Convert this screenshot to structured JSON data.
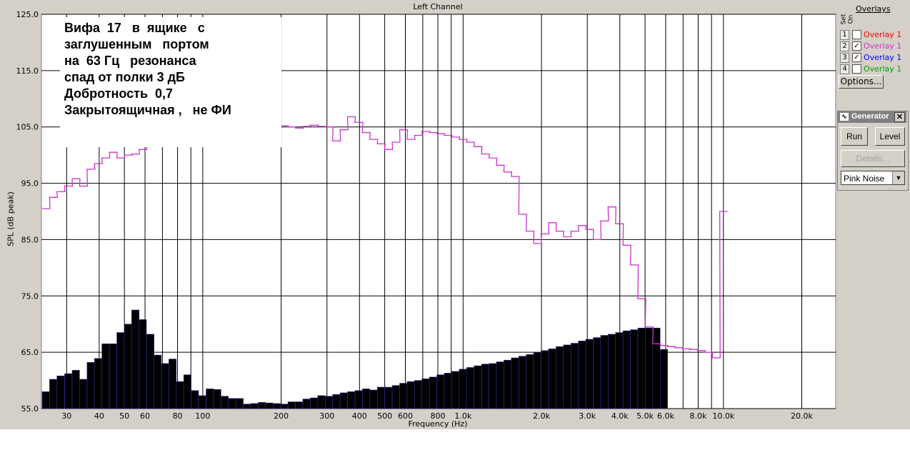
{
  "chart_data": {
    "type": "bar",
    "title": "Left Channel",
    "xlabel": "Frequency (Hz)",
    "ylabel": "SPL (dB peak)",
    "xscale": "log",
    "xlim": [
      24,
      27000
    ],
    "ylim": [
      55,
      125
    ],
    "grid": true,
    "yticks": [
      "125.0",
      "115.0",
      "105.0",
      "95.0",
      "85.0",
      "75.0",
      "65.0",
      "55.0"
    ],
    "xticks": [
      {
        "label": "30",
        "value": 30
      },
      {
        "label": "40",
        "value": 40
      },
      {
        "label": "50",
        "value": 50
      },
      {
        "label": "60",
        "value": 60
      },
      {
        "label": "80",
        "value": 80
      },
      {
        "label": "100",
        "value": 100
      },
      {
        "label": "200",
        "value": 200
      },
      {
        "label": "300",
        "value": 300
      },
      {
        "label": "400",
        "value": 400
      },
      {
        "label": "500",
        "value": 500
      },
      {
        "label": "600",
        "value": 600
      },
      {
        "label": "800",
        "value": 800
      },
      {
        "label": "1.0k",
        "value": 1000
      },
      {
        "label": "2.0k",
        "value": 2000
      },
      {
        "label": "3.0k",
        "value": 3000
      },
      {
        "label": "4.0k",
        "value": 4000
      },
      {
        "label": "5.0k",
        "value": 5000
      },
      {
        "label": "6.0k",
        "value": 6000
      },
      {
        "label": "8.0k",
        "value": 8000
      },
      {
        "label": "10.0k",
        "value": 10000
      },
      {
        "label": "20.0k",
        "value": 20000
      }
    ],
    "minor_gridlines": [
      70,
      90,
      700,
      900,
      7000,
      9000
    ],
    "band_centers": [
      25,
      26.7,
      28.5,
      30.5,
      32.6,
      34.8,
      37.2,
      39.7,
      42.4,
      45.3,
      48.4,
      51.7,
      55.2,
      58.9,
      63,
      67.2,
      71.8,
      76.7,
      81.9,
      87.5,
      93.4,
      99.8,
      106.6,
      113.9,
      121.6,
      129.9,
      138.7,
      148.2,
      158.2,
      169,
      180.5,
      192.8,
      205.9,
      219.9,
      234.9,
      250.9,
      268,
      286.2,
      305.7,
      326.5,
      348.7,
      372.4,
      397.8,
      424.9,
      453.8,
      484.7,
      517.7,
      552.9,
      590.5,
      630.7,
      673.6,
      719.5,
      768.5,
      820.8,
      876.6,
      936.3,
      1000,
      1068,
      1141,
      1219,
      1302,
      1390,
      1485,
      1586,
      1694,
      1809,
      1932,
      2064,
      2204,
      2354,
      2515,
      2686,
      2869,
      3064,
      3273,
      3495,
      3733,
      3987,
      4259,
      4548,
      4858,
      5188,
      5541,
      5919,
      6321,
      6752,
      7211,
      7702,
      8226,
      8786,
      9384,
      10020,
      10710,
      11440,
      12210,
      13050,
      13930,
      14880,
      15890,
      16980,
      18130,
      19370,
      20680,
      22090,
      23590,
      25200
    ],
    "series": [
      {
        "values": [
          58.0,
          60.2,
          60.8,
          61.2,
          61.8,
          60.2,
          63.2,
          63.9,
          66.5,
          66.5,
          68.5,
          70.0,
          72.5,
          70.8,
          68.2,
          64.5,
          63.0,
          63.8,
          59.8,
          61.0,
          58.2,
          57.3,
          58.5,
          58.4,
          57.2,
          56.8,
          56.8,
          55.8,
          55.9,
          56.1,
          56.0,
          55.9,
          55.8,
          56.2,
          56.2,
          56.7,
          56.9,
          57.3,
          57.2,
          57.5,
          57.8,
          58.0,
          58.2,
          58.5,
          58.3,
          58.8,
          58.8,
          59.1,
          59.5,
          59.8,
          60.0,
          60.3,
          60.6,
          61.0,
          61.3,
          61.6,
          62.0,
          62.3,
          62.6,
          62.9,
          63.0,
          63.3,
          63.6,
          64.0,
          64.3,
          64.6,
          65.0,
          65.3,
          65.6,
          66.0,
          66.3,
          66.6,
          67.0,
          67.3,
          67.6,
          68.0,
          68.2,
          68.5,
          68.8,
          69.0,
          69.3,
          69.3,
          69.3,
          65.5
        ],
        "color": "#000000"
      },
      {
        "values": [
          90.5,
          92.5,
          93.5,
          94.5,
          95.8,
          94.5,
          97.5,
          98.5,
          99.5,
          100.5,
          99.5,
          100.0,
          100.2,
          101.0,
          101.5,
          102.0,
          102.5,
          103.0,
          103.5,
          104.0,
          104.5,
          104.5,
          105.0,
          105.2,
          105.3,
          105.5,
          105.5,
          105.5,
          105.4,
          105.3,
          105.3,
          105.3,
          105.2,
          105.0,
          104.8,
          105.1,
          105.3,
          105.1,
          105.0,
          102.5,
          104.5,
          106.8,
          105.8,
          104.0,
          102.8,
          102.0,
          101.0,
          102.3,
          104.5,
          102.8,
          103.5,
          104.2,
          104.0,
          103.8,
          103.5,
          103.2,
          102.8,
          102.3,
          101.5,
          100.2,
          99.5,
          98.2,
          97.0,
          96.2,
          89.5,
          86.5,
          84.3,
          86.0,
          88.0,
          86.5,
          85.5,
          86.5,
          87.5,
          86.8,
          85.0,
          88.3,
          90.8,
          87.8,
          84.0,
          80.5,
          74.5,
          69.5,
          66.5,
          66.2,
          66.0,
          65.8,
          65.6,
          65.5,
          65.3,
          65.0,
          64.0,
          90.0
        ],
        "color": "#cc33cc"
      }
    ]
  },
  "annotation": {
    "lines": [
      "Вифа  17   в  ящике   с",
      "заглушенным   портом",
      "на  63 Гц   резонанса",
      "спад от полки 3 дБ",
      "Добротность  0,7",
      "Закрытоящичная ,   не ФИ"
    ]
  },
  "side_panel": {
    "title": "Overlays",
    "set_label": "Set",
    "on_label": "On",
    "overlays": [
      {
        "num": "1",
        "checked": false,
        "name": "Overlay 1",
        "color": "#ff0000"
      },
      {
        "num": "2",
        "checked": true,
        "name": "Overlay 1",
        "color": "#cc33cc"
      },
      {
        "num": "3",
        "checked": true,
        "name": "Overlay 1",
        "color": "#0000ff"
      },
      {
        "num": "4",
        "checked": false,
        "name": "Overlay 1",
        "color": "#00a000"
      }
    ],
    "options_label": "Options...",
    "generator": {
      "title": "Generator",
      "run_label": "Run",
      "level_label": "Level",
      "details_label": "Details...",
      "noise_value": "Pink Noise"
    }
  }
}
